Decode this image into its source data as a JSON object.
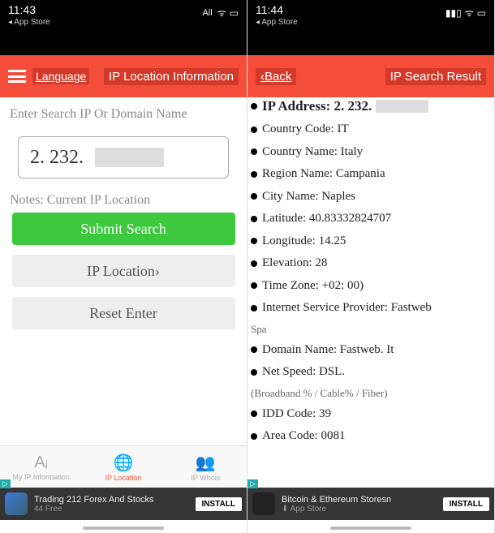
{
  "left": {
    "status": {
      "time": "11:43",
      "back": "◂ App Store",
      "carrier": "All"
    },
    "header": {
      "lang": "Language",
      "title": "IP Location Information"
    },
    "search": {
      "label": "Enter Search IP Or Domain Name",
      "value": "2. 232.",
      "notes": "Notes: Current IP Location",
      "submit": "Submit Search",
      "locbtn": "IP Location›",
      "reset": "Reset Enter"
    },
    "nav": {
      "a": "My IP Information",
      "b": "IP Location",
      "c": "IP Whois"
    },
    "ad": {
      "title": "Trading 212 Forex And Stocks",
      "sub": "44 Free",
      "btn": "INSTALL"
    }
  },
  "right": {
    "status": {
      "time": "11:44",
      "back": "◂ App Store"
    },
    "header": {
      "back": "‹Back",
      "title": "IP Search Result"
    },
    "results": {
      "ip": "IP Address: 2. 232.",
      "ccode": "Country Code: IT",
      "cname": "Country Name: Italy",
      "region": "Region Name: Campania",
      "city": "City Name: Naples",
      "lat": "Latitude: 40.83332824707",
      "lon": "Longitude: 14.25",
      "elev": "Elevation: 28",
      "tz": "Time Zone: +02: 00)",
      "isp": "Internet Service Provider: Fastweb",
      "spa": "Spa",
      "domain": "Domain Name: Fastweb. It",
      "speed": "Net Speed: DSL.",
      "speednote": "(Broadband % / Cable% / Fiber)",
      "idd": "IDD Code: 39",
      "area": "Area Code: 0081"
    },
    "ad": {
      "title": "Bitcoin & Ethereum Storesn",
      "sub": "⬇ App Store",
      "btn": "INSTALL"
    }
  }
}
